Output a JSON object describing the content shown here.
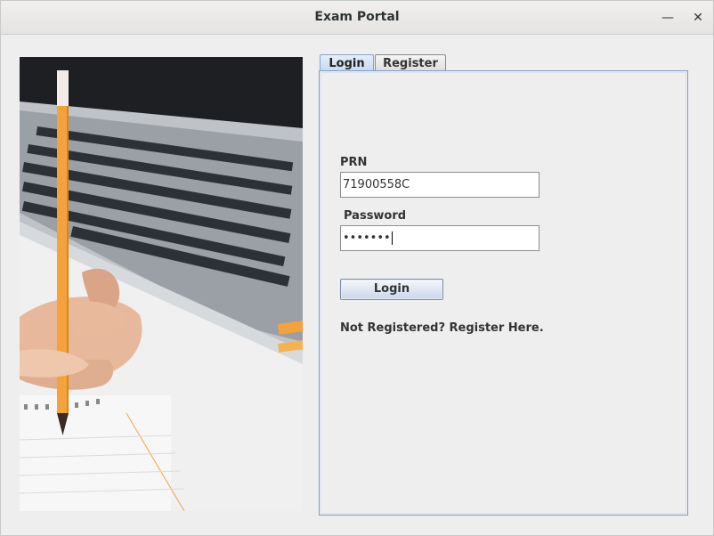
{
  "window": {
    "title": "Exam Portal"
  },
  "tabs": [
    {
      "label": "Login",
      "active": true
    },
    {
      "label": "Register",
      "active": false
    }
  ],
  "login": {
    "prn_label": "PRN",
    "prn_value": "71900558C",
    "password_label": "Password",
    "password_value": "•••••••",
    "submit_label": "Login",
    "register_prompt": "Not Registered? Register Here."
  },
  "colors": {
    "tab_border": "#7f9cc4",
    "button_gradient_bottom": "#c9d7ea",
    "pencil": "#f5a23a"
  }
}
